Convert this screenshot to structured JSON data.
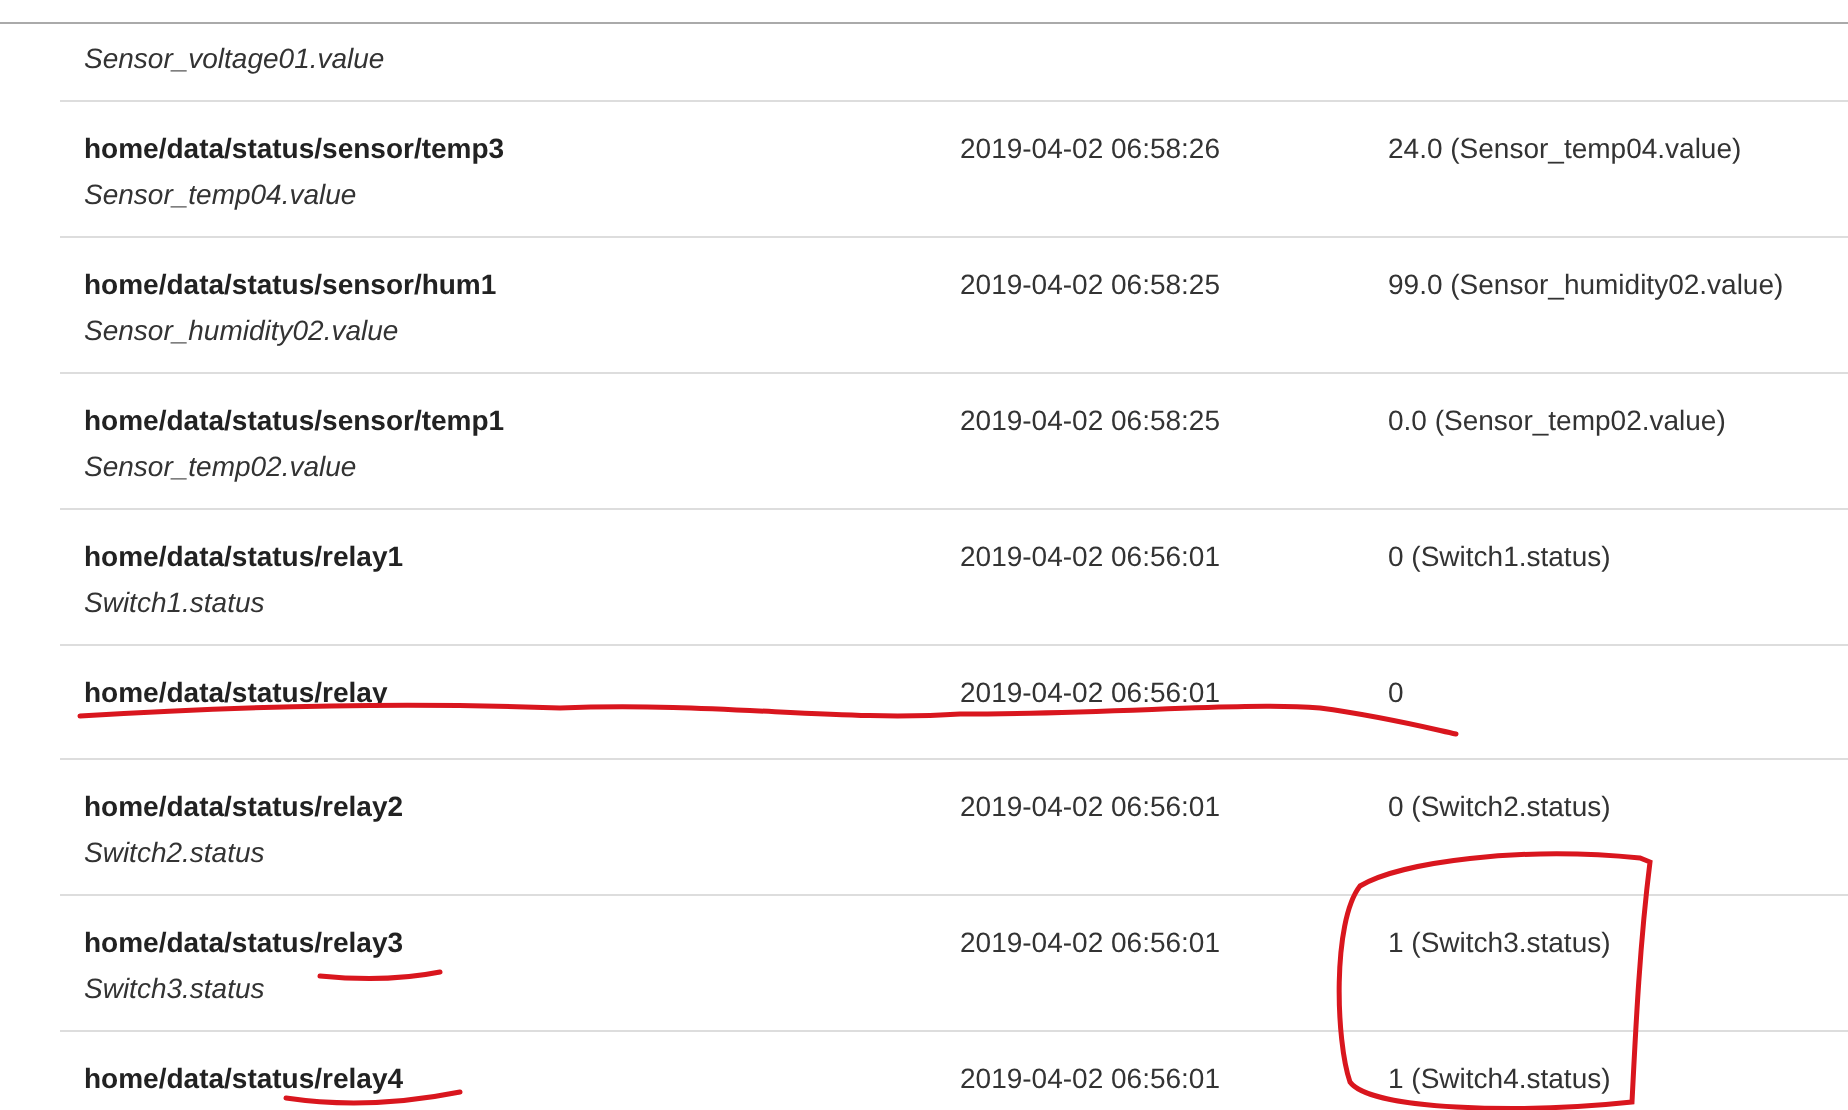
{
  "rows": [
    {
      "topic": "",
      "item": "Sensor_voltage01.value",
      "time": "",
      "value": ""
    },
    {
      "topic": "home/data/status/sensor/temp3",
      "item": "Sensor_temp04.value",
      "time": "2019-04-02 06:58:26",
      "value": "24.0 (Sensor_temp04.value)"
    },
    {
      "topic": "home/data/status/sensor/hum1",
      "item": "Sensor_humidity02.value",
      "time": "2019-04-02 06:58:25",
      "value": "99.0 (Sensor_humidity02.value)"
    },
    {
      "topic": "home/data/status/sensor/temp1",
      "item": "Sensor_temp02.value",
      "time": "2019-04-02 06:58:25",
      "value": "0.0 (Sensor_temp02.value)"
    },
    {
      "topic": "home/data/status/relay1",
      "item": "Switch1.status",
      "time": "2019-04-02 06:56:01",
      "value": "0 (Switch1.status)"
    },
    {
      "topic": "home/data/status/relay",
      "item": "",
      "time": "2019-04-02 06:56:01",
      "value": "0"
    },
    {
      "topic": "home/data/status/relay2",
      "item": "Switch2.status",
      "time": "2019-04-02 06:56:01",
      "value": "0 (Switch2.status)"
    },
    {
      "topic": "home/data/status/relay3",
      "item": "Switch3.status",
      "time": "2019-04-02 06:56:01",
      "value": "1 (Switch3.status)"
    },
    {
      "topic": "home/data/status/relay4",
      "item": "",
      "time": "2019-04-02 06:56:01",
      "value": "1 (Switch4.status)"
    }
  ],
  "annotations": [
    {
      "kind": "underline"
    },
    {
      "kind": "underline"
    },
    {
      "kind": "underline"
    },
    {
      "kind": "circle"
    }
  ]
}
